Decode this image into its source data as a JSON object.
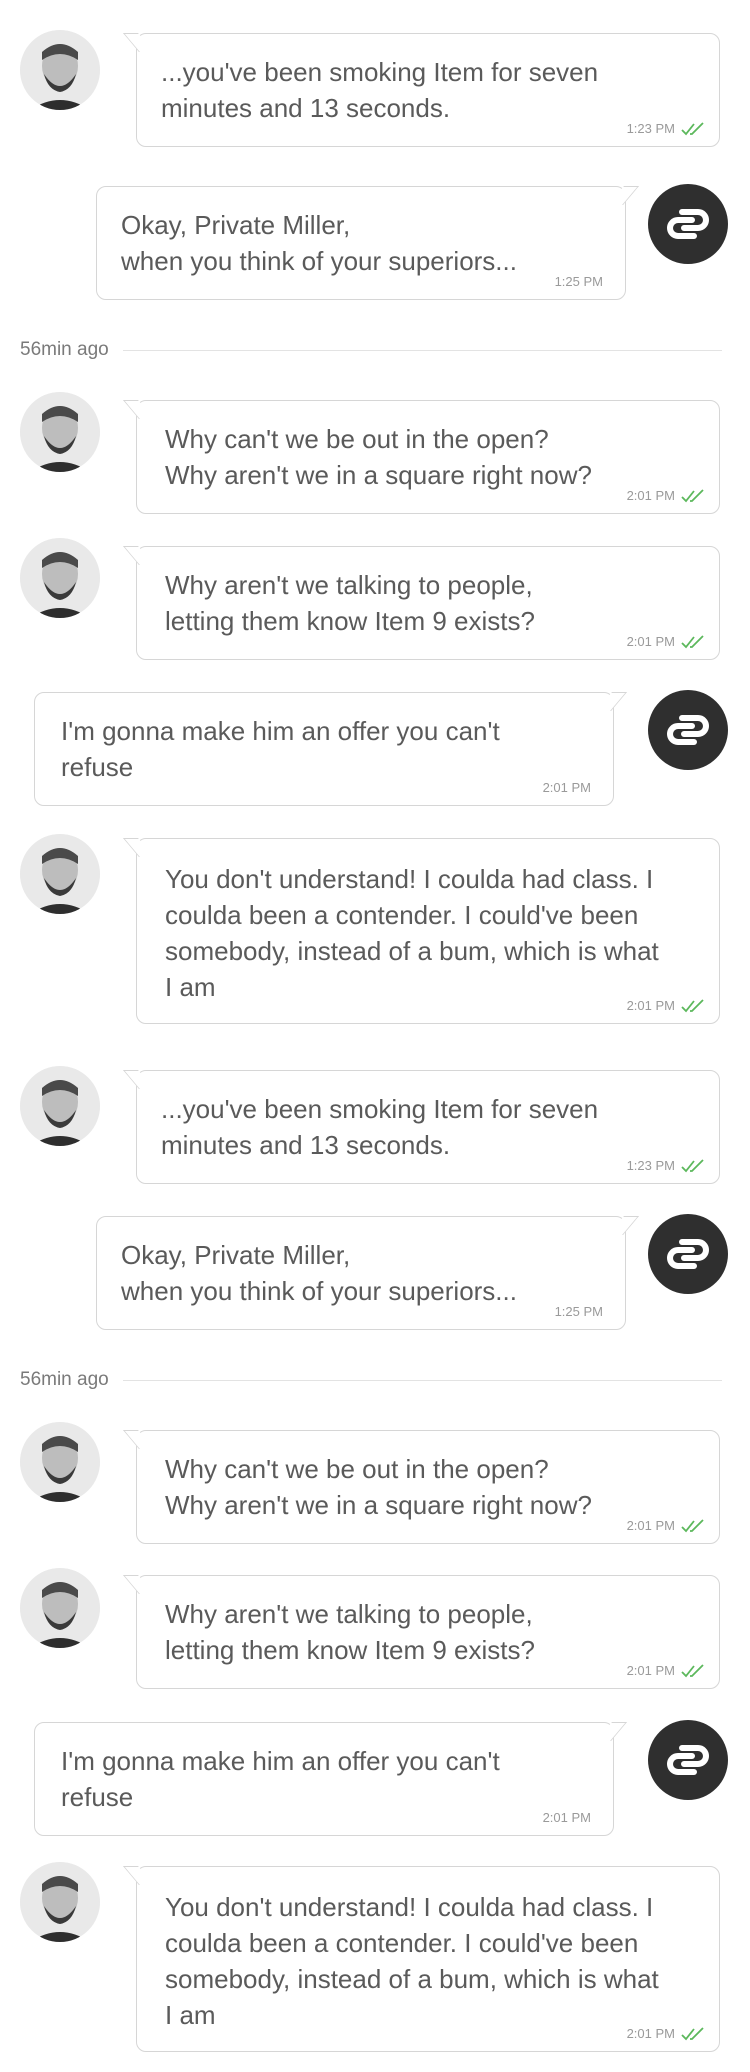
{
  "messages": [
    {
      "text": "...you've been smoking Item for seven\nminutes and 13 seconds.",
      "time": "1:23 PM"
    },
    {
      "text": "Okay, Private Miller,\nwhen you think of your superiors...",
      "time": "1:25 PM"
    },
    {
      "text": "Why can't we be out in the open?\nWhy aren't we in a square right now?",
      "time": "2:01 PM"
    },
    {
      "text": "Why aren't we talking to people,\nletting them know Item 9 exists?",
      "time": "2:01 PM"
    },
    {
      "text": "I'm gonna make him an offer you can't\nrefuse",
      "time": "2:01 PM"
    },
    {
      "text": "You don't understand! I coulda had class. I\ncoulda been a contender. I could've been\nsomebody, instead of a bum, which is what\nI am",
      "time": "2:01 PM"
    },
    {
      "text": "...you've been smoking Item for seven\nminutes and 13 seconds.",
      "time": "1:23 PM"
    },
    {
      "text": "Okay, Private Miller,\nwhen you think of your superiors...",
      "time": "1:25 PM"
    },
    {
      "text": "Why can't we be out in the open?\nWhy aren't we in a square right now?",
      "time": "2:01 PM"
    },
    {
      "text": "Why aren't we talking to people,\nletting them know Item 9 exists?",
      "time": "2:01 PM"
    },
    {
      "text": "I'm gonna make him an offer you can't\nrefuse",
      "time": "2:01 PM"
    },
    {
      "text": "You don't understand! I coulda had class. I\ncoulda been a contender. I could've been\nsomebody, instead of a bum, which is what\nI am",
      "time": "2:01 PM"
    }
  ],
  "dividers": [
    "56min ago",
    "56min ago"
  ],
  "colors": {
    "check": "#5cb85c",
    "bot_avatar": "#2f2f2f",
    "bubble_border": "#d6d6d6"
  }
}
